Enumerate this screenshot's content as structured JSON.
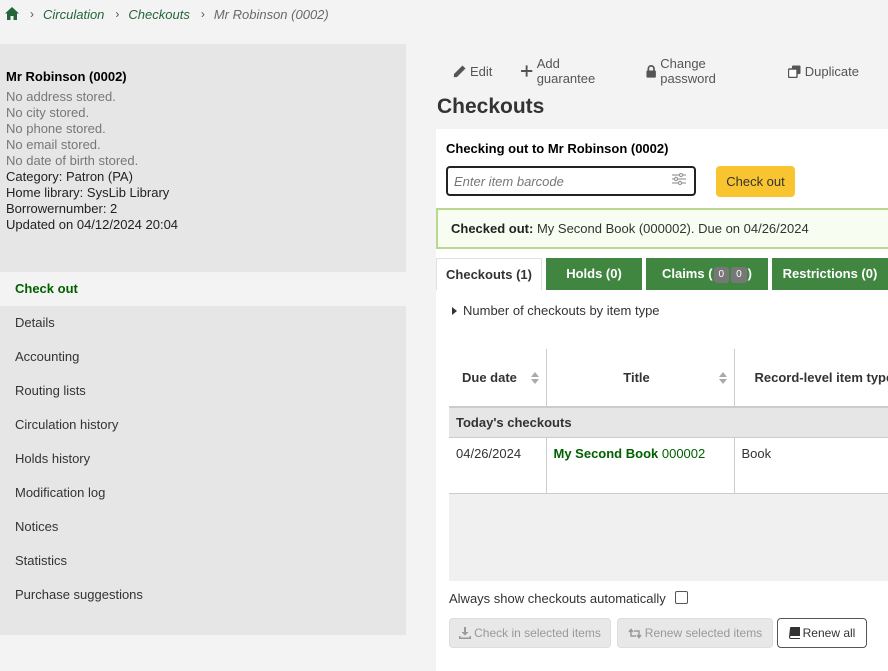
{
  "breadcrumb": {
    "home_icon": "home-icon",
    "items": [
      "Circulation",
      "Checkouts",
      "Mr Robinson (0002)"
    ]
  },
  "patron": {
    "name": "Mr Robinson (0002)",
    "address": "No address stored.",
    "city": "No city stored.",
    "phone": "No phone stored.",
    "email": "No email stored.",
    "dob": "No date of birth stored.",
    "category": "Category: Patron (PA)",
    "library": "Home library: SysLib Library",
    "borrowernumber": "Borrowernumber: 2",
    "updated": "Updated on 04/12/2024 20:04"
  },
  "sidenav": {
    "items": [
      "Check out",
      "Details",
      "Accounting",
      "Routing lists",
      "Circulation history",
      "Holds history",
      "Modification log",
      "Notices",
      "Statistics",
      "Purchase suggestions"
    ]
  },
  "toolbar": {
    "edit": "Edit",
    "add_guarantee": "Add guarantee",
    "change_password": "Change password",
    "duplicate": "Duplicate"
  },
  "page_title": "Checkouts",
  "checkout": {
    "label": "Checking out to Mr Robinson (0002)",
    "placeholder": "Enter item barcode",
    "button": "Check out"
  },
  "alert": {
    "label": "Checked out:",
    "text": " My Second Book (000002). Due on 04/26/2024"
  },
  "tabs": {
    "checkouts": "Checkouts (1)",
    "holds": "Holds (0)",
    "claims_prefix": "Claims (",
    "claims_badge1": "0",
    "claims_badge2": "0",
    "claims_suffix": ")",
    "restrictions": "Restrictions (0)"
  },
  "summary": "Number of checkouts by item type",
  "table": {
    "headers": [
      "Due date",
      "Title",
      "Record-level item type"
    ],
    "group": "Today's checkouts",
    "rows": [
      {
        "due": "04/26/2024",
        "title": "My Second Book",
        "barcode": " 000002",
        "type": "Book"
      }
    ]
  },
  "autoshow_label": "Always show checkouts automatically",
  "buttons": {
    "checkin": "Check in selected items",
    "renew_selected": "Renew selected items",
    "renew_all": "Renew all"
  },
  "colors": {
    "accent_green": "#408540",
    "link_green": "#006100",
    "checkout_yellow": "#f8c42f"
  }
}
